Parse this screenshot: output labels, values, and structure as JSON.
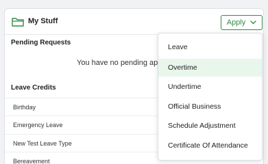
{
  "card": {
    "title": "My Stuff",
    "apply_label": "Apply"
  },
  "pending": {
    "title": "Pending Requests",
    "empty_message": "You have no pending ap"
  },
  "leave_credits": {
    "title": "Leave Credits",
    "rows": [
      "Birthday",
      "Emergency Leave",
      "New Test Leave Type",
      "Bereavement"
    ]
  },
  "apply_menu": {
    "items": [
      "Leave",
      "Overtime",
      "Undertime",
      "Official Business",
      "Schedule Adjustment",
      "Certificate Of Attendance"
    ],
    "highlighted": "Overtime"
  },
  "colors": {
    "accent": "#2e8b45",
    "highlight": "#e9f6ec"
  }
}
